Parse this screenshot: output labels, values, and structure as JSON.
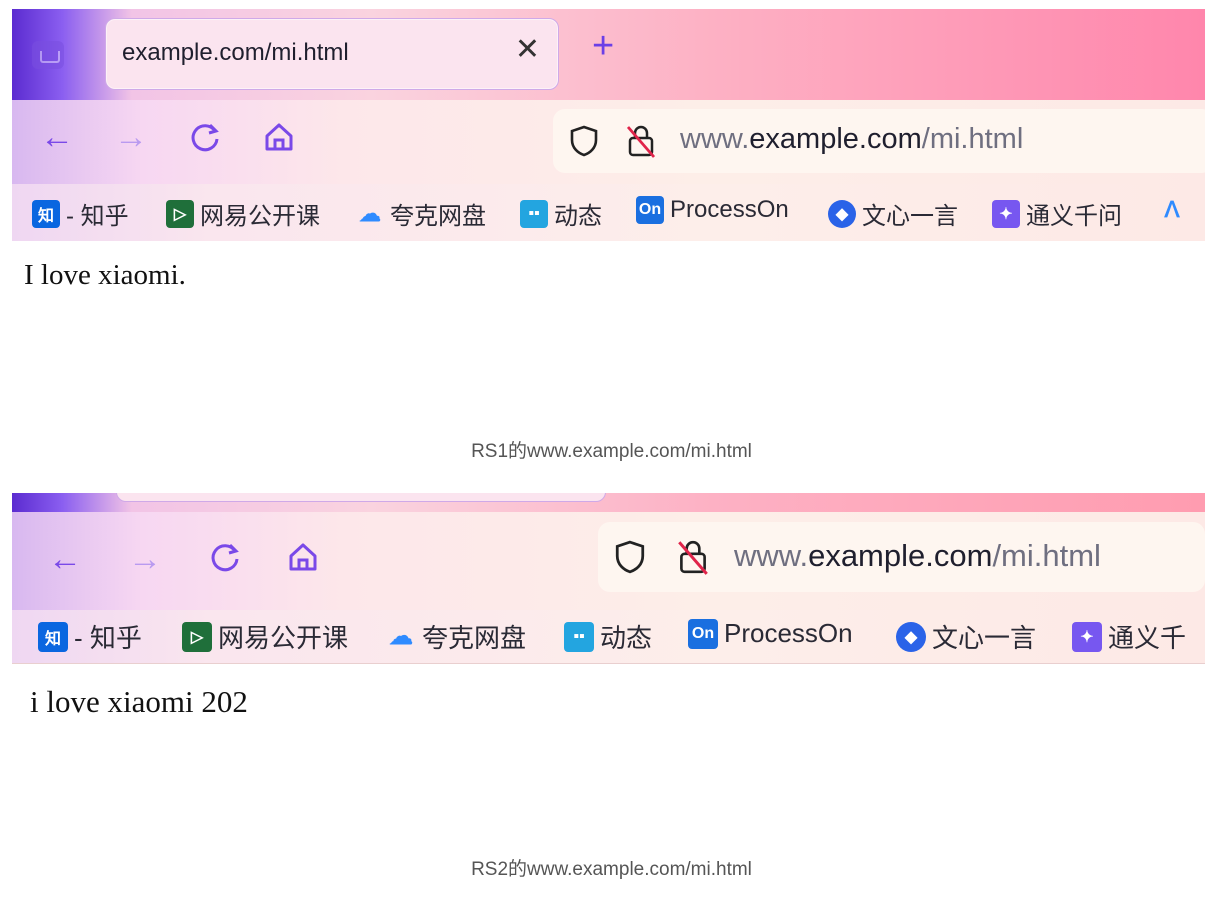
{
  "screenshots": [
    {
      "tab_title": "example.com/mi.html",
      "url": {
        "prefix": "www.",
        "domain": "example.com",
        "path": "/mi.html"
      },
      "bookmarks": [
        "- 知乎",
        "网易公开课",
        "夸克网盘",
        "动态",
        "ProcessOn",
        "文心一言",
        "通义千问"
      ],
      "bookmark_icon_labels": {
        "zhihu": "知",
        "processon": "On"
      },
      "page_text": "I love xiaomi.",
      "caption": "RS1的www.example.com/mi.html"
    },
    {
      "url": {
        "prefix": "www.",
        "domain": "example.com",
        "path": "/mi.html"
      },
      "bookmarks": [
        "- 知乎",
        "网易公开课",
        "夸克网盘",
        "动态",
        "ProcessOn",
        "文心一言",
        "通义千"
      ],
      "bookmark_icon_labels": {
        "zhihu": "知",
        "processon": "On"
      },
      "page_text": "i love xiaomi 202",
      "caption": "RS2的www.example.com/mi.html"
    }
  ],
  "icons": [
    "tabs-icon",
    "close-icon",
    "new-tab-icon",
    "back-icon",
    "forward-icon",
    "reload-icon",
    "home-icon",
    "shield-icon",
    "insecure-lock-icon"
  ],
  "colors": {
    "accent": "#6b3fe6",
    "zhihu": "#0a66e0",
    "netease": "#1f6f3a",
    "quark": "#2f8bff",
    "bilibili": "#23a5e0",
    "processon": "#1a6fe0",
    "wenxin": "#2a63e8",
    "tongyi": "#7757f0"
  }
}
